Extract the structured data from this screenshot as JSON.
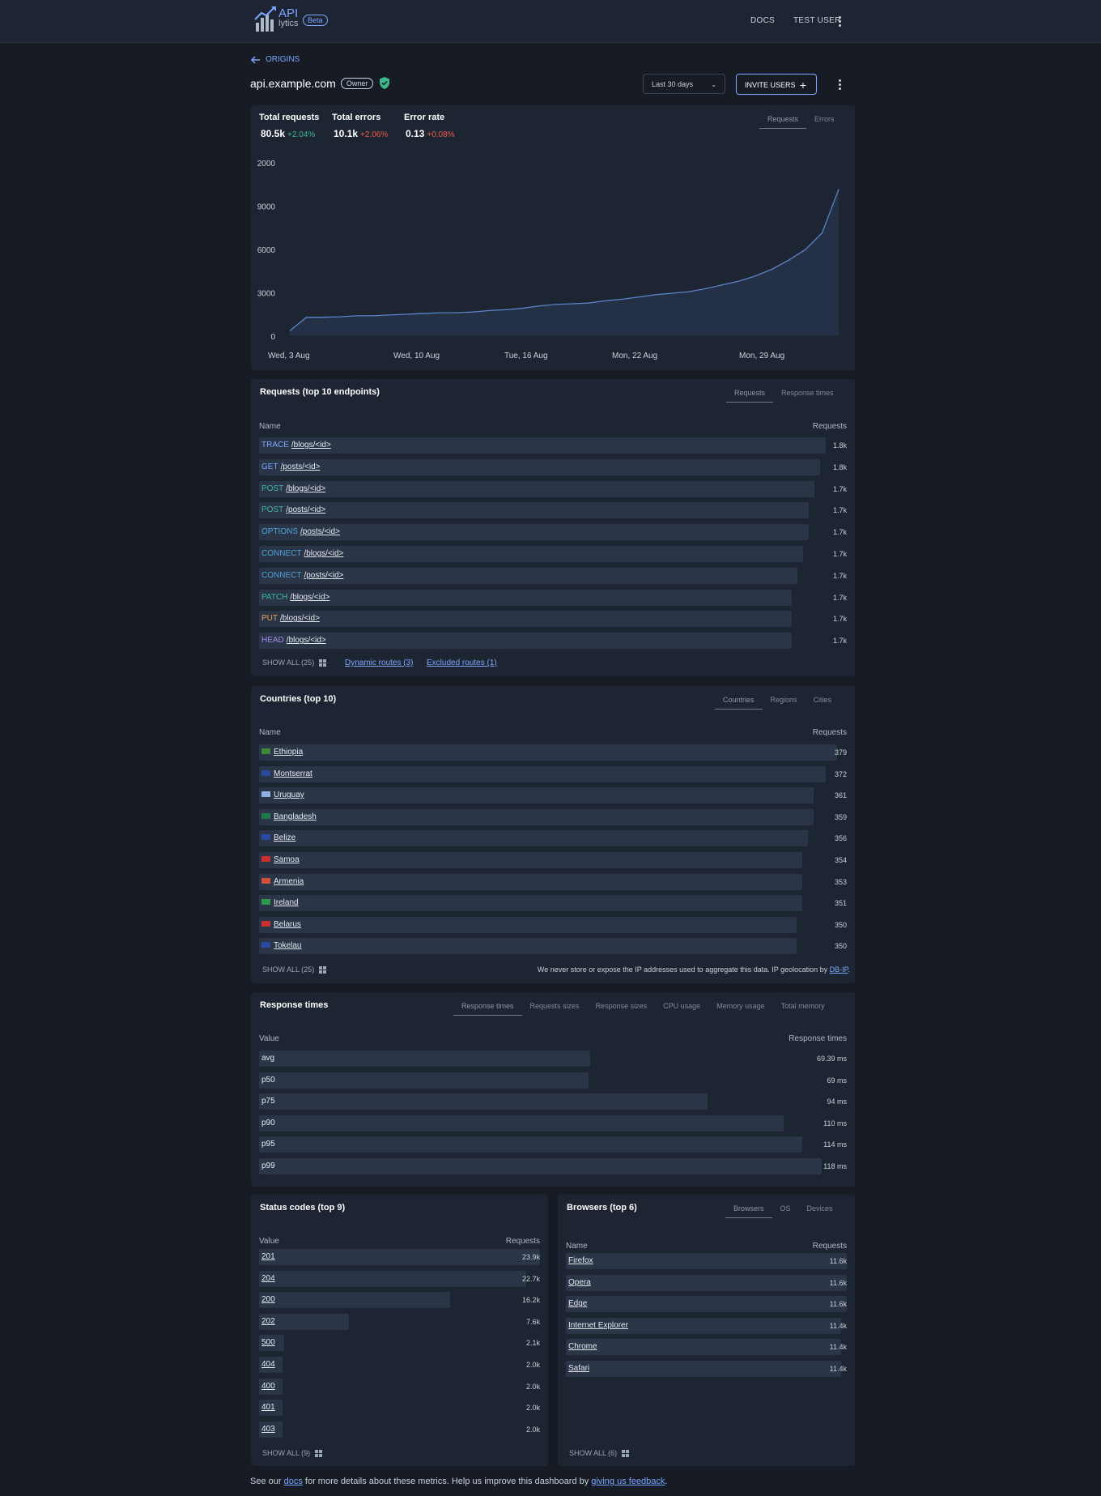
{
  "header": {
    "logo_title": "API",
    "logo_sub": "lytics",
    "beta": "Beta",
    "docs": "DOCS",
    "user": "TEST USER"
  },
  "nav": {
    "back_label": "ORIGINS"
  },
  "origin": {
    "title": "api.example.com",
    "role": "Owner",
    "range": "Last 30 days",
    "invite": "INVITE USERS"
  },
  "summary": {
    "tabs": [
      "Requests",
      "Errors"
    ],
    "metrics": [
      {
        "label": "Total requests",
        "value": "80.5k",
        "change": "+2.04%",
        "color": "#3fb68b"
      },
      {
        "label": "Total errors",
        "value": "10.1k",
        "change": "+2.06%",
        "color": "#ef5b4d"
      },
      {
        "label": "Error rate",
        "value": "0.13",
        "change": "+0.08%",
        "color": "#ef5b4d"
      }
    ]
  },
  "chart_data": {
    "type": "area",
    "yticks": [
      "2000",
      "9000",
      "6000",
      "3000",
      "0"
    ],
    "xticks": [
      "Wed, 3 Aug",
      "Wed, 10 Aug",
      "Tue, 16 Aug",
      "Mon, 22 Aug",
      "Mon, 29 Aug"
    ],
    "series": [
      {
        "values": [
          300,
          1200,
          1200,
          1230,
          1300,
          1300,
          1350,
          1400,
          1450,
          1500,
          1500,
          1550,
          1650,
          1700,
          1800,
          1950,
          2050,
          2100,
          2150,
          2300,
          2400,
          2550,
          2700,
          2800,
          2900,
          3100,
          3350,
          3600,
          3950,
          4400,
          5000,
          5700,
          6800,
          9700
        ]
      }
    ],
    "ylim": [
      0,
      12000
    ],
    "line_color": "#5a83c7"
  },
  "endpoints": {
    "title": "Requests (top 10 endpoints)",
    "tabs": [
      "Requests",
      "Response times"
    ],
    "col_name": "Name",
    "col_value": "Requests",
    "rows": [
      {
        "method": "TRACE",
        "path": "/blogs/<id>",
        "value": "1.8k",
        "fraction": 1.0,
        "color": "#7ba7ff"
      },
      {
        "method": "GET",
        "path": "/posts/<id>",
        "value": "1.8k",
        "fraction": 0.99,
        "color": "#7ba7ff"
      },
      {
        "method": "POST",
        "path": "/blogs/<id>",
        "value": "1.7k",
        "fraction": 0.98,
        "color": "#3fb6a8"
      },
      {
        "method": "POST",
        "path": "/posts/<id>",
        "value": "1.7k",
        "fraction": 0.97,
        "color": "#3fb6a8"
      },
      {
        "method": "OPTIONS",
        "path": "/posts/<id>",
        "value": "1.7k",
        "fraction": 0.97,
        "color": "#4fa3d9"
      },
      {
        "method": "CONNECT",
        "path": "/blogs/<id>",
        "value": "1.7k",
        "fraction": 0.96,
        "color": "#4fa3d9"
      },
      {
        "method": "CONNECT",
        "path": "/posts/<id>",
        "value": "1.7k",
        "fraction": 0.95,
        "color": "#4fa3d9"
      },
      {
        "method": "PATCH",
        "path": "/blogs/<id>",
        "value": "1.7k",
        "fraction": 0.94,
        "color": "#3fb6a8"
      },
      {
        "method": "PUT",
        "path": "/blogs/<id>",
        "value": "1.7k",
        "fraction": 0.94,
        "color": "#e8a24b"
      },
      {
        "method": "HEAD",
        "path": "/blogs/<id>",
        "value": "1.7k",
        "fraction": 0.94,
        "color": "#a98ae8"
      }
    ],
    "show_all": "SHOW ALL (25)",
    "dynamic": "Dynamic routes (3)",
    "excluded": "Excluded routes (1)"
  },
  "countries": {
    "title": "Countries (top 10)",
    "tabs": [
      "Countries",
      "Regions",
      "Cities"
    ],
    "col_name": "Name",
    "col_value": "Requests",
    "rows": [
      {
        "name": "Ethiopia",
        "value": "379",
        "fraction": 1.0,
        "flag": "#3a8a3a"
      },
      {
        "name": "Montserrat",
        "value": "372",
        "fraction": 0.98,
        "flag": "#2a4aa0"
      },
      {
        "name": "Uruguay",
        "value": "361",
        "fraction": 0.96,
        "flag": "#8fb0e0"
      },
      {
        "name": "Bangladesh",
        "value": "359",
        "fraction": 0.96,
        "flag": "#1f7a4a"
      },
      {
        "name": "Belize",
        "value": "356",
        "fraction": 0.95,
        "flag": "#2a4aa0"
      },
      {
        "name": "Samoa",
        "value": "354",
        "fraction": 0.94,
        "flag": "#c53030"
      },
      {
        "name": "Armenia",
        "value": "353",
        "fraction": 0.94,
        "flag": "#d0503a"
      },
      {
        "name": "Ireland",
        "value": "351",
        "fraction": 0.94,
        "flag": "#2d9a4a"
      },
      {
        "name": "Belarus",
        "value": "350",
        "fraction": 0.93,
        "flag": "#c53030"
      },
      {
        "name": "Tokelau",
        "value": "350",
        "fraction": 0.93,
        "flag": "#2a4aa0"
      }
    ],
    "show_all": "SHOW ALL (25)",
    "note_prefix": "We never store or expose the IP addresses used to aggregate this data. IP geolocation by ",
    "note_link": "DB-IP",
    "note_suffix": "."
  },
  "response_times": {
    "title": "Response times",
    "tabs": [
      "Response times",
      "Requests sizes",
      "Response sizes",
      "CPU usage",
      "Memory usage",
      "Total memory"
    ],
    "col_name": "Value",
    "col_value": "Response times",
    "rows": [
      {
        "name": "avg",
        "value": "69.39 ms",
        "fraction": 0.588
      },
      {
        "name": "p50",
        "value": "69 ms",
        "fraction": 0.585
      },
      {
        "name": "p75",
        "value": "94 ms",
        "fraction": 0.797
      },
      {
        "name": "p90",
        "value": "110 ms",
        "fraction": 0.932
      },
      {
        "name": "p95",
        "value": "114 ms",
        "fraction": 0.966
      },
      {
        "name": "p99",
        "value": "118 ms",
        "fraction": 1.0
      }
    ]
  },
  "status_codes": {
    "title": "Status codes (top 9)",
    "col_name": "Value",
    "col_value": "Requests",
    "rows": [
      {
        "name": "201",
        "value": "23.9k",
        "fraction": 1.0
      },
      {
        "name": "204",
        "value": "22.7k",
        "fraction": 0.95
      },
      {
        "name": "200",
        "value": "16.2k",
        "fraction": 0.68
      },
      {
        "name": "202",
        "value": "7.6k",
        "fraction": 0.32
      },
      {
        "name": "500",
        "value": "2.1k",
        "fraction": 0.09
      },
      {
        "name": "404",
        "value": "2.0k",
        "fraction": 0.084
      },
      {
        "name": "400",
        "value": "2.0k",
        "fraction": 0.084
      },
      {
        "name": "401",
        "value": "2.0k",
        "fraction": 0.084
      },
      {
        "name": "403",
        "value": "2.0k",
        "fraction": 0.084
      }
    ],
    "show_all": "SHOW ALL (9)"
  },
  "browsers": {
    "title": "Browsers (top 6)",
    "tabs": [
      "Browsers",
      "OS",
      "Devices"
    ],
    "col_name": "Name",
    "col_value": "Requests",
    "rows": [
      {
        "name": "Firefox",
        "value": "11.6k",
        "fraction": 1.0
      },
      {
        "name": "Opera",
        "value": "11.6k",
        "fraction": 1.0
      },
      {
        "name": "Edge",
        "value": "11.6k",
        "fraction": 1.0
      },
      {
        "name": "Internet Explorer",
        "value": "11.4k",
        "fraction": 0.98
      },
      {
        "name": "Chrome",
        "value": "11.4k",
        "fraction": 0.98
      },
      {
        "name": "Safari",
        "value": "11.4k",
        "fraction": 0.98
      }
    ],
    "show_all": "SHOW ALL (6)"
  },
  "footer": {
    "prefix": "See our ",
    "docs": "docs",
    "middle": " for more details about these metrics. Help us improve this dashboard by ",
    "feedback": "giving us feedback",
    "suffix": "."
  }
}
